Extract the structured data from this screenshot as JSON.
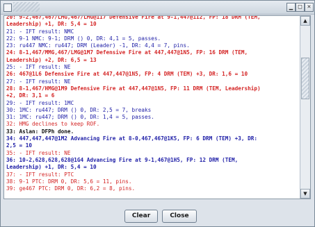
{
  "window": {
    "minimize_symbol": "▁",
    "maximize_symbol": "□",
    "close_symbol": "✕"
  },
  "colors": {
    "red": "#d42525",
    "blue": "#2121a8",
    "black": "#111111"
  },
  "log_lines": [
    {
      "text": "20: 9-2,467,467/LMG,467/LMG@1I7 Defensive Fire at 9-1,447@1I2, FP: 18 DRM (TEM,",
      "color": "#d42525",
      "bold": true
    },
    {
      "text": "Leadership) +1, DR: 5,4 = 10",
      "color": "#d42525",
      "bold": true
    },
    {
      "text": "21: - IFT result: NMC",
      "color": "#2121a8",
      "bold": false
    },
    {
      "text": "22: 9-1 NMC: 9-1; DRM () 0, DR: 4,1 = 5, passes.",
      "color": "#2121a8",
      "bold": false
    },
    {
      "text": "23: ru447 NMC: ru447; DRM (Leader) -1, DR: 4,4 = 7, pins.",
      "color": "#2121a8",
      "bold": false
    },
    {
      "text": "24: 8-1,467/MMG,467/LMG@1M7 Defensive Fire at 447,447@1N5, FP: 16 DRM (TEM,",
      "color": "#d42525",
      "bold": true
    },
    {
      "text": "Leadership) +2, DR: 6,5 = 13",
      "color": "#d42525",
      "bold": true
    },
    {
      "text": "25: - IFT result: NE",
      "color": "#2121a8",
      "bold": false
    },
    {
      "text": "26: 467@1L6 Defensive Fire at 447,447@1N5, FP: 4 DRM (TEM) +3, DR: 1,6 = 10",
      "color": "#d42525",
      "bold": true
    },
    {
      "text": "27: - IFT result: NE",
      "color": "#2121a8",
      "bold": false
    },
    {
      "text": "28: 8-1,467/HMG@1M9 Defensive Fire at 447,447@1N5, FP: 11 DRM (TEM, Leadership)",
      "color": "#d42525",
      "bold": true
    },
    {
      "text": "+2, DR: 3,1 = 6",
      "color": "#d42525",
      "bold": true
    },
    {
      "text": "29: - IFT result: 1MC",
      "color": "#2121a8",
      "bold": false
    },
    {
      "text": "30: 1MC: ru447; DRM () 0, DR: 2,5 = 7, breaks",
      "color": "#2121a8",
      "bold": false
    },
    {
      "text": "31: 1MC: ru447; DRM () 0, DR: 1,4 = 5, passes.",
      "color": "#2121a8",
      "bold": false
    },
    {
      "text": "32: HMG declines to keep ROF.",
      "color": "#d42525",
      "bold": false
    },
    {
      "text": "33: Aslan: DFPh done.",
      "color": "#111111",
      "bold": true
    },
    {
      "text": "34: 447,447,447@1M2 Advancing Fire at 8-0,467,467@1K5, FP: 6 DRM (TEM) +3, DR:",
      "color": "#2121a8",
      "bold": true
    },
    {
      "text": "2,5 = 10",
      "color": "#2121a8",
      "bold": true
    },
    {
      "text": "35: - IFT result: NE",
      "color": "#d42525",
      "bold": false
    },
    {
      "text": "36: 10-2,628,628,628@1G4 Advancing Fire at 9-1,467@1H5, FP: 12 DRM (TEM,",
      "color": "#2121a8",
      "bold": true
    },
    {
      "text": "Leadership) +1, DR: 5,4 = 10",
      "color": "#2121a8",
      "bold": true
    },
    {
      "text": "37: - IFT result: PTC",
      "color": "#d42525",
      "bold": false
    },
    {
      "text": "38: 9-1 PTC: DRM 0, DR: 5,6 = 11, pins.",
      "color": "#d42525",
      "bold": false
    },
    {
      "text": "39: ge467 PTC: DRM 0, DR: 6,2 = 8, pins.",
      "color": "#d42525",
      "bold": false
    }
  ],
  "scrollbar": {
    "up_symbol": "▲",
    "down_symbol": "▼"
  },
  "buttons": {
    "clear_label": "Clear",
    "close_label": "Close"
  }
}
